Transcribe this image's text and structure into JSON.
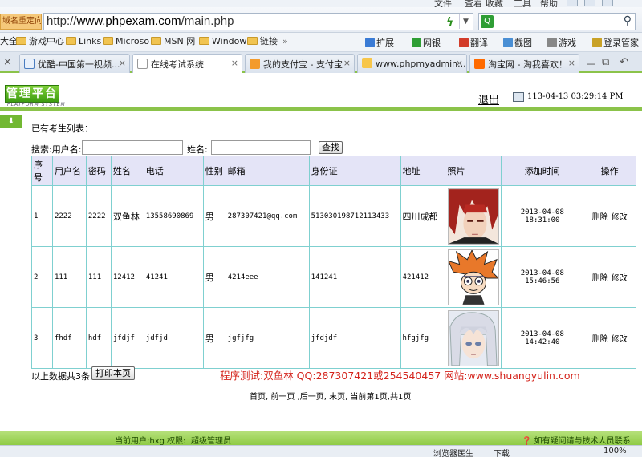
{
  "browser": {
    "menu": [
      "文件",
      "查看",
      "收藏",
      "工具",
      "帮助"
    ],
    "redirect_label": "域名重定向",
    "url": "http://www.phpexam.com/main.php",
    "favorites": [
      "大全",
      "游戏中心",
      "Links",
      "Microso",
      "MSN 网",
      "Window",
      "链接"
    ],
    "tools": [
      "扩展",
      "网银",
      "翻译",
      "截图",
      "游戏",
      "登录管家"
    ],
    "tabs": [
      {
        "label": "优酷-中国第一视频..."
      },
      {
        "label": "在线考试系统",
        "active": true
      },
      {
        "label": "我的支付宝 - 支付宝"
      },
      {
        "label": "www.phpmyadmin...."
      },
      {
        "label": "淘宝网 - 淘我喜欢！"
      }
    ]
  },
  "header": {
    "logo": "管理平台",
    "logo_sub": "PLATFORM SYSTEM",
    "logout": "退出",
    "datetime": "113-04-13 03:29:14 PM"
  },
  "content": {
    "list_title": "已有考生列表：",
    "search_label": "搜索:用户名:",
    "name_label": "姓名:",
    "search_button": "查找",
    "columns": [
      "序号",
      "用户名",
      "密码",
      "姓名",
      "电话",
      "性别",
      "邮箱",
      "身份证",
      "地址",
      "照片",
      "添加时间",
      "操作"
    ],
    "rows": [
      {
        "id": "1",
        "username": "2222",
        "password": "2222",
        "name": "双鱼林",
        "phone": "13558690869",
        "gender": "男",
        "email": "287307421@qq.com",
        "idcard": "513030198712113433",
        "address": "四川成都",
        "added": "2013-04-08 18:31:00",
        "photo": "red-hair-anime-avatar"
      },
      {
        "id": "2",
        "username": "111",
        "password": "111",
        "name": "12412",
        "phone": "41241",
        "gender": "男",
        "email": "4214eee",
        "idcard": "141241",
        "address": "421412",
        "added": "2013-04-08 15:46:56",
        "photo": "spiky-orange-hair-anime-avatar"
      },
      {
        "id": "3",
        "username": "fhdf",
        "password": "hdf",
        "name": "jfdjf",
        "phone": "jdfjd",
        "gender": "男",
        "email": "jgfjfg",
        "idcard": "jfdjdf",
        "address": "hfgjfg",
        "added": "2013-04-08 14:42:40",
        "photo": "silver-hair-anime-avatar"
      }
    ],
    "delete_label": "删除",
    "edit_label": "修改",
    "summary": "以上数据共3条,",
    "print_button": "打印本页",
    "credit": "程序测试:双鱼林 QQ:287307421或254540457 网站:www.shuangyulin.com",
    "pager": "首页, 前一页 ,后一页, 末页, 当前第1页,共1页"
  },
  "footer": {
    "current_user": "当前用户:hxg 权限:",
    "role": "超级管理员",
    "help": "如有疑问请与技术人员联系"
  },
  "statusbar": {
    "items": [
      "浏览器医生",
      "下载",
      "100%"
    ]
  },
  "colors": {
    "accent_green": "#8bc34a",
    "table_border": "#7fd0d0",
    "header_bg": "#e4e4f7",
    "credit_red": "#d4241c"
  }
}
